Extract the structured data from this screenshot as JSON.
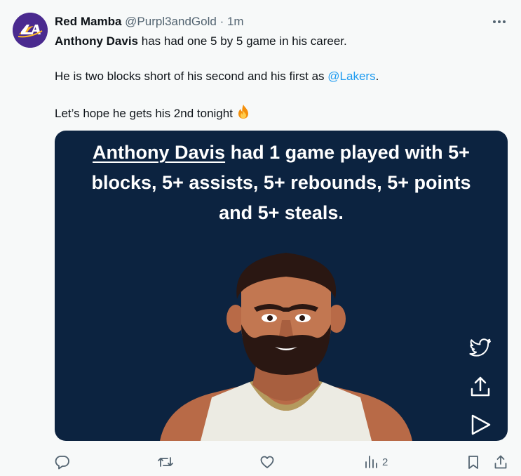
{
  "tweet": {
    "author_name": "Red Mamba",
    "handle": "@Purpl3andGold",
    "separator": "·",
    "time": "1m",
    "line1_bold": "Anthony Davis",
    "line1_rest": " has had one 5 by 5 game in his career.",
    "line2_pre": "He is two blocks short of his second and his first as ",
    "line2_mention": "@Lakers",
    "line2_post": ".",
    "line3": "Let’s hope he gets his 2nd tonight",
    "fire_icon": "fire-emoji"
  },
  "media": {
    "headline_underlined": "Anthony Davis",
    "headline_line1_rest": " had 1 game played with 5+",
    "headline_line2": "blocks, 5+ assists, 5+ rebounds, 5+ points",
    "headline_line3": "and 5+ steals.",
    "background_color": "#0c2340",
    "side_icons": [
      "twitter-bird-icon",
      "share-icon",
      "play-icon"
    ]
  },
  "actions": {
    "reply_icon": "reply-icon",
    "retweet_icon": "retweet-icon",
    "like_icon": "heart-icon",
    "views_icon": "views-chart-icon",
    "views_count": "2",
    "bookmark_icon": "bookmark-icon",
    "share_icon": "share-icon"
  },
  "colors": {
    "accent": "#1d9bf0",
    "muted": "#536471",
    "avatar_bg": "#4a2a8f"
  }
}
